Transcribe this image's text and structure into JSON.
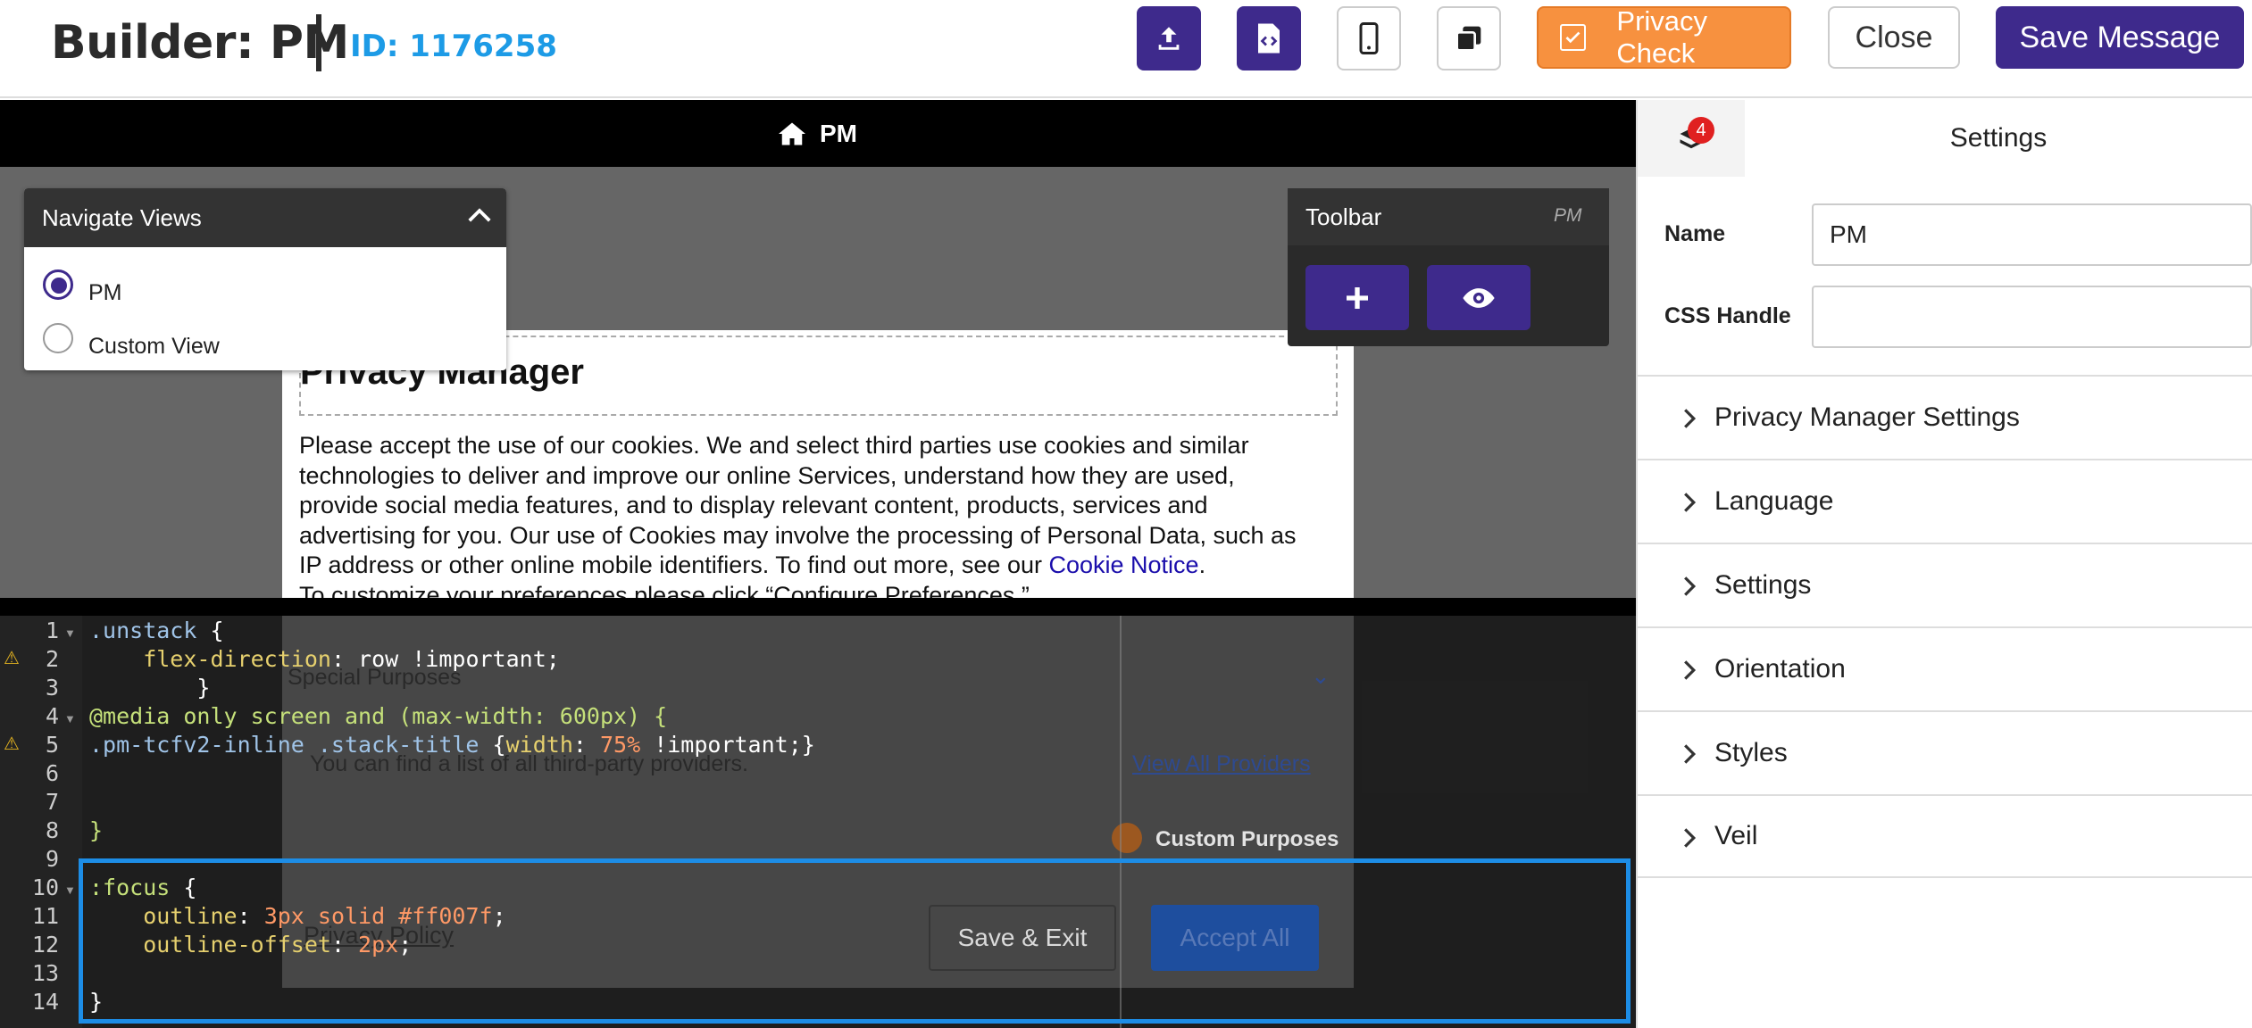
{
  "header": {
    "title": "Builder: PM",
    "message_id": "ID: 1176258",
    "buttons": {
      "upload": "upload-icon",
      "code": "code-file-icon",
      "mobile": "mobile-icon",
      "copy": "copy-icon"
    },
    "privacy_check_label": "Privacy Check",
    "close_label": "Close",
    "save_label": "Save Message"
  },
  "canvas": {
    "view_name": "PM",
    "privacy_manager": {
      "title": "Privacy Manager",
      "body_lines": [
        "Please accept the use of our cookies. We and select third parties use cookies and similar",
        "technologies to deliver and improve our online Services, understand how they are used,",
        "provide social media features, and to display relevant content, products, services and",
        "advertising for you. Our use of Cookies may involve the processing of Personal Data, such as",
        "IP address or other online mobile identifiers. To find out more, see our"
      ],
      "cookie_link": "Cookie Notice",
      "body_cut": "To customize your preferences please click “Configure Preferences.”",
      "special_purposes": "Special Purposes",
      "providers_text": "You can find a list of all third-party providers.",
      "view_all_providers": "View All Providers",
      "custom_purposes": "Custom Purposes",
      "privacy_policy": "Privacy Policy",
      "save_exit": "Save & Exit",
      "accept_all": "Accept All"
    }
  },
  "navigate_views": {
    "title": "Navigate Views",
    "options": [
      {
        "label": "PM",
        "selected": true
      },
      {
        "label": "Custom View",
        "selected": false
      }
    ]
  },
  "toolbar": {
    "title": "Toolbar",
    "tag": "PM"
  },
  "editor": {
    "line_numbers": [
      "1",
      "2",
      "3",
      "4",
      "5",
      "6",
      "7",
      "8",
      "9",
      "10",
      "11",
      "12",
      "13",
      "14"
    ],
    "lines": {
      "l1_sel": ".unstack",
      "l1_rest": " {",
      "l2_prop": "    flex-direction",
      "l2_rest": ": row !important;",
      "l3": "        }",
      "l4": "@media only screen and (max-width: 600px) {",
      "l5_sel": ".pm-tcfv2-inline .stack-title",
      "l5_a": " {",
      "l5_prop": "width",
      "l5_b": ": ",
      "l5_val": "75%",
      "l5_c": " !important;}",
      "l8": "}",
      "l10_sel": ":focus",
      "l10_rest": " {",
      "l11_prop": "    outline",
      "l11_b": ": ",
      "l11_val": "3px solid #ff007f",
      "l11_c": ";",
      "l12_prop": "    outline-offset",
      "l12_b": ": ",
      "l12_val": "2px",
      "l12_c": ";",
      "l14": "}"
    }
  },
  "right_panel": {
    "badge_count": "4",
    "tab_label": "Settings",
    "name_label": "Name",
    "name_value": "PM",
    "css_handle_label": "CSS Handle",
    "css_handle_value": "",
    "sections": [
      "Privacy Manager Settings",
      "Language",
      "Settings",
      "Orientation",
      "Styles",
      "Veil"
    ]
  },
  "colors": {
    "brand_purple": "#3e2a8c",
    "privacy_check_orange": "#f7913f",
    "id_blue": "#1d9be6",
    "highlight_blue": "#1d8de6"
  }
}
